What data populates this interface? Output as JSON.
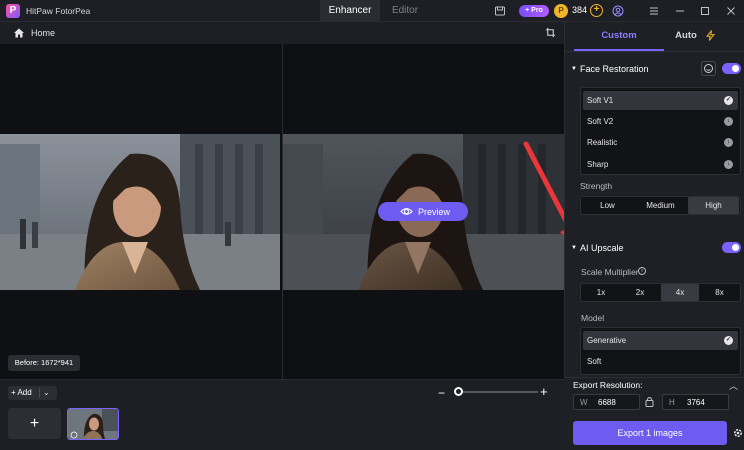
{
  "app": {
    "name": "HitPaw FotorPea",
    "logo_letter": "P"
  },
  "tabs": {
    "enhancer": "Enhancer",
    "editor": "Editor"
  },
  "titlebar": {
    "pro_badge": "+ Pro",
    "credits": "384",
    "coin_symbol": "P",
    "add_credits": "+"
  },
  "toolbar": {
    "home_label": "Home"
  },
  "canvas": {
    "preview_label": "Preview",
    "before_info": "Before: 1672*941"
  },
  "bottom": {
    "add_label": "+ Add",
    "add_dropdown": "⌄",
    "zoom_minus": "−",
    "zoom_plus": "+",
    "add_tile": "+",
    "zoom_level": 0.0
  },
  "panel": {
    "tab_custom": "Custom",
    "tab_auto": "Auto",
    "face_restoration": {
      "title": "Face Restoration",
      "enabled": true,
      "models": [
        {
          "label": "Soft V1",
          "selected": true
        },
        {
          "label": "Soft V2",
          "selected": false
        },
        {
          "label": "Realistic",
          "selected": false
        },
        {
          "label": "Sharp",
          "selected": false
        }
      ],
      "strength_label": "Strength",
      "strength_options": [
        "Low",
        "Medium",
        "High"
      ],
      "strength_selected": "High"
    },
    "ai_upscale": {
      "title": "AI Upscale",
      "enabled": true,
      "scale_label": "Scale Multiplier",
      "scale_options": [
        "1x",
        "2x",
        "4x",
        "8x"
      ],
      "scale_selected": "4x",
      "model_label": "Model",
      "models": [
        {
          "label": "Generative",
          "selected": true
        },
        {
          "label": "Soft",
          "selected": false
        }
      ]
    },
    "export": {
      "resolution_label": "Export Resolution:",
      "width_key": "W",
      "width_value": "6688",
      "height_key": "H",
      "height_value": "3764",
      "button_label": "Export 1 images"
    }
  },
  "colors": {
    "accent": "#6e5bf0",
    "accent_text": "#8f7bff",
    "annotation_arrow": "#e8363a"
  }
}
